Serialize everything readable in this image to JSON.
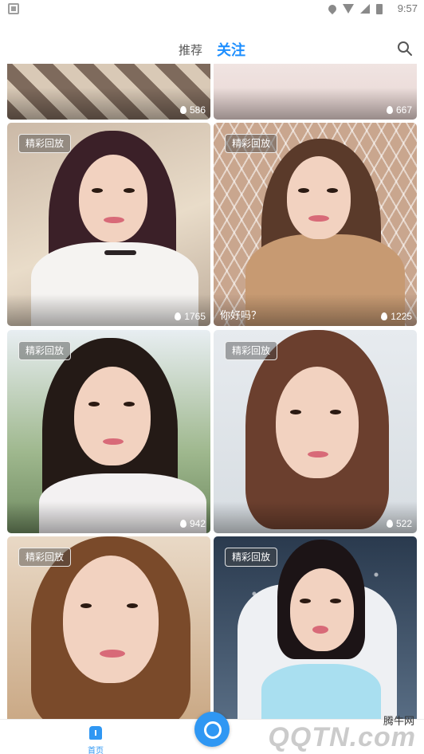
{
  "status_bar": {
    "time": "9:57"
  },
  "nav": {
    "tabs": [
      {
        "label": "推荐",
        "active": false
      },
      {
        "label": "关注",
        "active": true
      }
    ],
    "accent_color": "#1e8fff"
  },
  "feed": {
    "top_partial": [
      {
        "views": "586"
      },
      {
        "views": "667"
      }
    ],
    "cards": [
      {
        "badge": "精彩回放",
        "caption": "",
        "views": "1765"
      },
      {
        "badge": "精彩回放",
        "caption": "你好吗？",
        "views": "1225"
      },
      {
        "badge": "精彩回放",
        "caption": "",
        "views": "942"
      },
      {
        "badge": "精彩回放",
        "caption": "",
        "views": "522"
      },
      {
        "badge": "精彩回放",
        "caption": "",
        "views": ""
      },
      {
        "badge": "精彩回放",
        "caption": "",
        "views": ""
      }
    ]
  },
  "bottom_bar": {
    "home_label": "首页",
    "watermark_brand": "腾牛网",
    "watermark_url": "QQTN.com"
  }
}
